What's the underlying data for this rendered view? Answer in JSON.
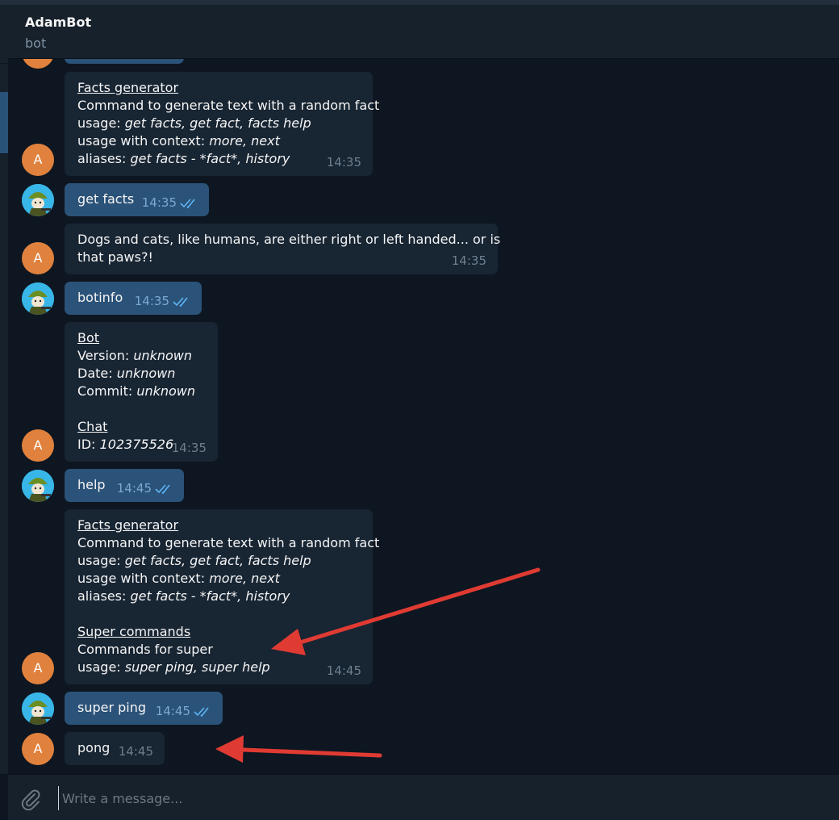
{
  "chat": {
    "name": "AdamBot",
    "status": "bot"
  },
  "avatar_letter": "A",
  "messages": {
    "m1": {
      "lines": [
        [
          {
            "t": "Facts generator",
            "s": "u"
          }
        ],
        [
          {
            "t": "Command to generate text with a random fact"
          }
        ],
        [
          {
            "t": "usage: "
          },
          {
            "t": "get facts, get fact, facts help",
            "s": "i"
          }
        ],
        [
          {
            "t": "usage with context: "
          },
          {
            "t": "more, next",
            "s": "i"
          }
        ],
        [
          {
            "t": "aliases: "
          },
          {
            "t": "get facts - *fact*, history",
            "s": "i"
          }
        ]
      ],
      "time": "14:35"
    },
    "m2": {
      "text": "get facts",
      "time": "14:35"
    },
    "m3": {
      "lines": [
        [
          {
            "t": "Dogs and cats, like humans, are either right or left handed... or is"
          }
        ],
        [
          {
            "t": "that paws?!"
          }
        ]
      ],
      "time": "14:35"
    },
    "m4": {
      "text": "botinfo",
      "time": "14:35"
    },
    "m5": {
      "lines": [
        [
          {
            "t": "Bot",
            "s": "u"
          }
        ],
        [
          {
            "t": "Version: "
          },
          {
            "t": "unknown",
            "s": "i"
          }
        ],
        [
          {
            "t": "Date: "
          },
          {
            "t": "unknown",
            "s": "i"
          }
        ],
        [
          {
            "t": "Commit: "
          },
          {
            "t": "unknown",
            "s": "i"
          }
        ],
        [
          {
            "t": " "
          }
        ],
        [
          {
            "t": "Chat",
            "s": "u"
          }
        ],
        [
          {
            "t": "ID: "
          },
          {
            "t": "102375526",
            "s": "i"
          }
        ]
      ],
      "time": "14:35"
    },
    "m6": {
      "text": "help",
      "time": "14:45"
    },
    "m7": {
      "lines": [
        [
          {
            "t": "Facts generator",
            "s": "u"
          }
        ],
        [
          {
            "t": "Command to generate text with a random fact"
          }
        ],
        [
          {
            "t": "usage: "
          },
          {
            "t": "get facts, get fact, facts help",
            "s": "i"
          }
        ],
        [
          {
            "t": "usage with context: "
          },
          {
            "t": "more, next",
            "s": "i"
          }
        ],
        [
          {
            "t": "aliases: "
          },
          {
            "t": "get facts - *fact*, history",
            "s": "i"
          }
        ],
        [
          {
            "t": " "
          }
        ],
        [
          {
            "t": "Super commands",
            "s": "u"
          }
        ],
        [
          {
            "t": "Commands for super"
          }
        ],
        [
          {
            "t": "usage: "
          },
          {
            "t": "super ping, super help",
            "s": "i"
          }
        ]
      ],
      "time": "14:45"
    },
    "m8": {
      "text": "super ping",
      "time": "14:45"
    },
    "m9": {
      "text": "pong",
      "time": "14:45"
    }
  },
  "composer": {
    "placeholder": "Write a message..."
  },
  "colors": {
    "background": "#0e1621",
    "incoming_bubble": "#182533",
    "outgoing_bubble": "#2b5278",
    "avatar": "#e0823d",
    "annotation_arrow": "#e03b33",
    "read_ticks": "#5eb5f7"
  },
  "icons": [
    "double-check-icon",
    "paperclip-icon",
    "soldier-avatar-icon"
  ]
}
